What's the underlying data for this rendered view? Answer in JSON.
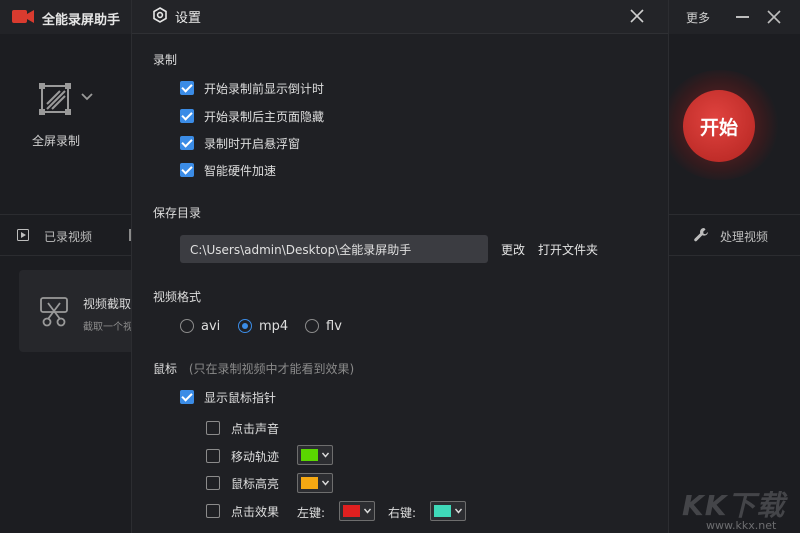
{
  "main": {
    "app_title": "全能录屏助手",
    "more_label": "更多",
    "mode_label": "全屏录制",
    "start_label": "开始",
    "tab_recorded": "已录视频",
    "tab_process": "处理视频",
    "card_title": "视频截取",
    "card_sub": "截取一个视频"
  },
  "dialog": {
    "title": "设置",
    "record": {
      "label": "录制",
      "options": [
        {
          "label": "开始录制前显示倒计时",
          "checked": true
        },
        {
          "label": "开始录制后主页面隐藏",
          "checked": true
        },
        {
          "label": "录制时开启悬浮窗",
          "checked": true
        },
        {
          "label": "智能硬件加速",
          "checked": true
        }
      ]
    },
    "save_dir": {
      "label": "保存目录",
      "path": "C:\\Users\\admin\\Desktop\\全能录屏助手",
      "change_label": "更改",
      "open_label": "打开文件夹"
    },
    "format": {
      "label": "视频格式",
      "options": [
        "avi",
        "mp4",
        "flv"
      ],
      "selected": "mp4"
    },
    "mouse": {
      "label": "鼠标",
      "hint": "(只在录制视频中才能看到效果)",
      "show_pointer": {
        "label": "显示鼠标指针",
        "checked": true
      },
      "click_sound": {
        "label": "点击声音",
        "checked": false
      },
      "move_trail": {
        "label": "移动轨迹",
        "checked": false,
        "color": "#5ad700"
      },
      "highlight": {
        "label": "鼠标高亮",
        "checked": false,
        "color": "#f5a812"
      },
      "click_effect": {
        "label": "点击效果",
        "checked": false,
        "left_label": "左键:",
        "left_color": "#e02020",
        "right_label": "右键:",
        "right_color": "#3fd9b9"
      }
    }
  },
  "watermark": {
    "text": "KK下载",
    "url": "www.kkx.net"
  }
}
